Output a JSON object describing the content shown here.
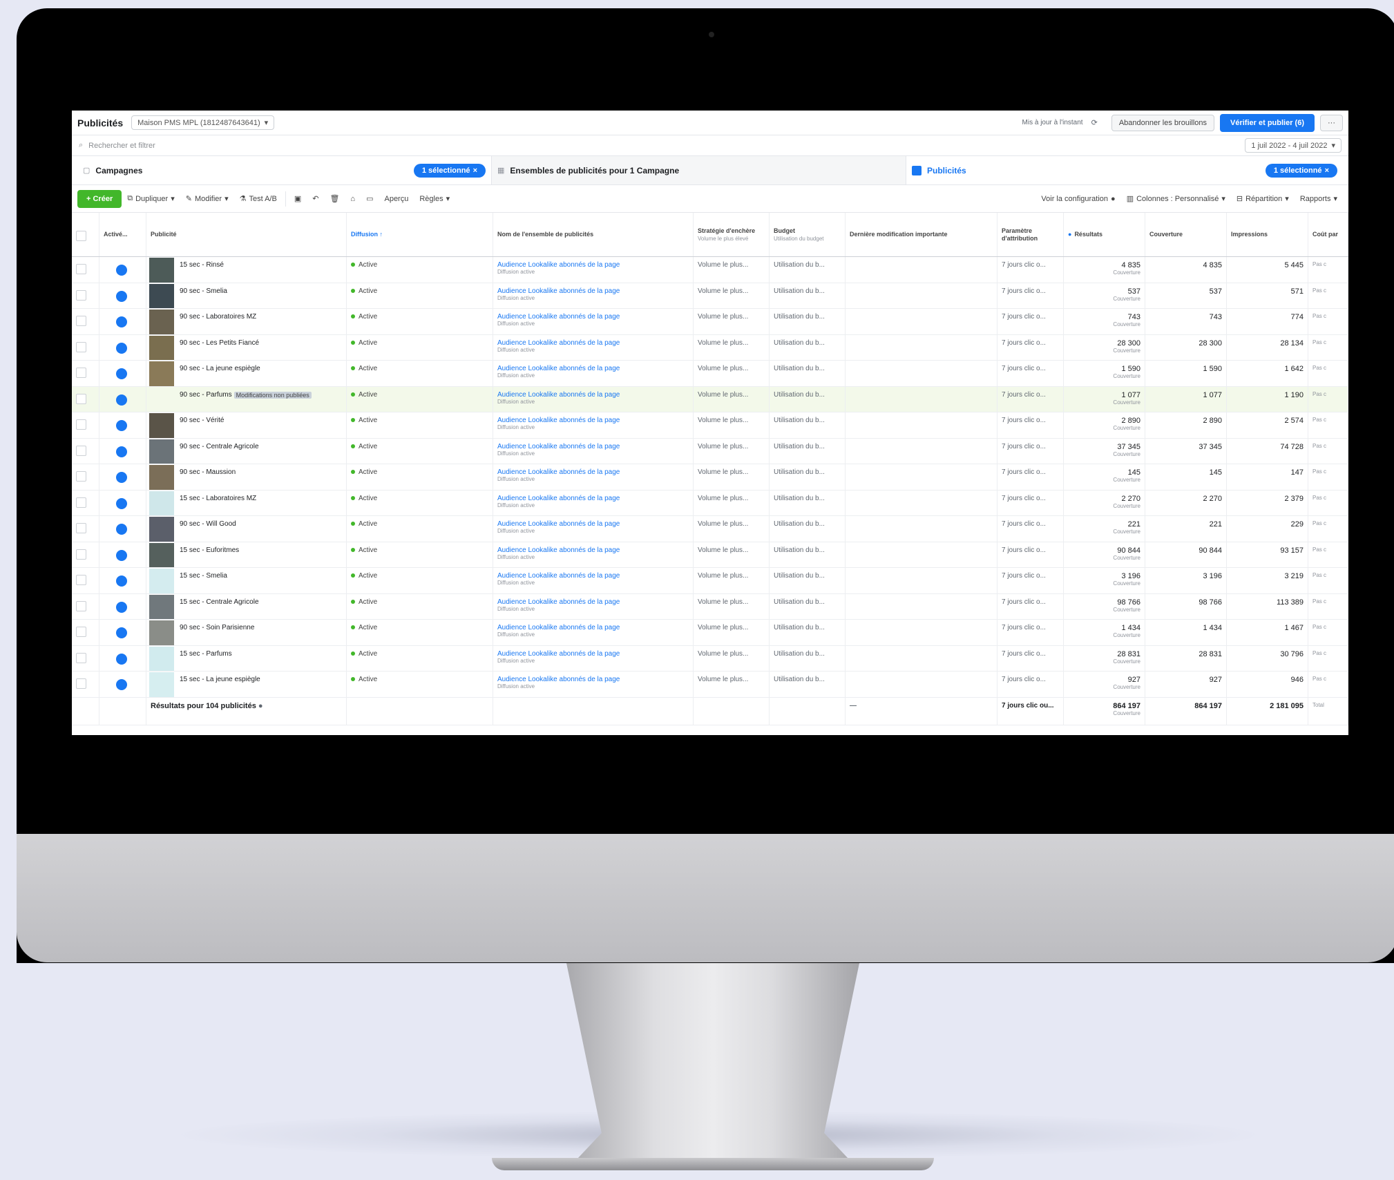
{
  "topbar": {
    "title": "Publicités",
    "account": "Maison PMS MPL (1812487643641)",
    "update": "Mis à jour à l'instant",
    "discard": "Abandonner les brouillons",
    "publish": "Vérifier et publier (6)",
    "more": "···"
  },
  "search": {
    "placeholder": "Rechercher et filtrer",
    "daterange": "1 juil 2022 - 4 juil 2022"
  },
  "tabs": {
    "campaigns": "Campagnes",
    "campaigns_pill": "1 sélectionné",
    "adsets": "Ensembles de publicités pour 1 Campagne",
    "ads": "Publicités",
    "ads_pill": "1 sélectionné"
  },
  "toolbar": {
    "create": "+ Créer",
    "duplicate": "Dupliquer",
    "edit": "Modifier",
    "ab_test": "Test A/B",
    "preview": "Aperçu",
    "rules": "Règles",
    "config": "Voir la configuration",
    "columns": "Colonnes : Personnalisé",
    "breakdown": "Répartition",
    "reports": "Rapports"
  },
  "columns": {
    "active": "Activé...",
    "ad": "Publicité",
    "delivery": "Diffusion ↑",
    "adset": "Nom de l'ensemble de publicités",
    "strategy": "Stratégie d'enchère",
    "strategy_sub": "Volume le plus élevé",
    "budget": "Budget",
    "budget_sub": "Utilisation du budget",
    "recent": "Dernière modification importante",
    "attribution": "Paramètre d'attribution",
    "results": "Résultats",
    "impressions": "Couverture",
    "reach": "Impressions",
    "cost": "Coût par"
  },
  "rows": [
    {
      "name": "15 sec - Rinsé",
      "set": "Audience Lookalike abonnés de la page",
      "results": "4 835",
      "imp": "4 835",
      "reach": "5 445",
      "thumb": "#4d5b58"
    },
    {
      "name": "90 sec - Smelia",
      "set": "Audience Lookalike abonnés de la page",
      "results": "537",
      "imp": "537",
      "reach": "571",
      "thumb": "#3d4a52"
    },
    {
      "name": "90 sec - Laboratoires MZ",
      "set": "Audience Lookalike abonnés de la page",
      "results": "743",
      "imp": "743",
      "reach": "774",
      "thumb": "#6a6250"
    },
    {
      "name": "90 sec - Les Petits Fiancé",
      "set": "Audience Lookalike abonnés de la page",
      "results": "28 300",
      "imp": "28 300",
      "reach": "28 134",
      "thumb": "#7a6e4f"
    },
    {
      "name": "90 sec - La jeune espiègle",
      "set": "Audience Lookalike abonnés de la page",
      "results": "1 590",
      "imp": "1 590",
      "reach": "1 642",
      "thumb": "#8a7a58"
    },
    {
      "name": "90 sec - Parfums",
      "tag": "Modifications non publiées",
      "set": "Audience Lookalike abonnés de la page",
      "results": "1 077",
      "imp": "1 077",
      "reach": "1 190",
      "thumb": "",
      "hl": true
    },
    {
      "name": "90 sec - Vérité",
      "set": "Audience Lookalike abonnés de la page",
      "results": "2 890",
      "imp": "2 890",
      "reach": "2 574",
      "thumb": "#5a5448"
    },
    {
      "name": "90 sec - Centrale Agricole",
      "set": "Audience Lookalike abonnés de la page",
      "results": "37 345",
      "imp": "37 345",
      "reach": "74 728",
      "thumb": "#6b7378"
    },
    {
      "name": "90 sec - Maussion",
      "set": "Audience Lookalike abonnés de la page",
      "results": "145",
      "imp": "145",
      "reach": "147",
      "thumb": "#7b6e58"
    },
    {
      "name": "15 sec - Laboratoires MZ",
      "set": "Audience Lookalike abonnés de la page",
      "results": "2 270",
      "imp": "2 270",
      "reach": "2 379",
      "thumb": "#cfe7ea"
    },
    {
      "name": "90 sec - Will Good",
      "set": "Audience Lookalike abonnés de la page",
      "results": "221",
      "imp": "221",
      "reach": "229",
      "thumb": "#5b5f6a"
    },
    {
      "name": "15 sec - Euforitmes",
      "set": "Audience Lookalike abonnés de la page",
      "results": "90 844",
      "imp": "90 844",
      "reach": "93 157",
      "thumb": "#55605d"
    },
    {
      "name": "15 sec - Smelia",
      "set": "Audience Lookalike abonnés de la page",
      "results": "3 196",
      "imp": "3 196",
      "reach": "3 219",
      "thumb": "#d4ecef"
    },
    {
      "name": "15 sec - Centrale Agricole",
      "set": "Audience Lookalike abonnés de la page",
      "results": "98 766",
      "imp": "98 766",
      "reach": "113 389",
      "thumb": "#70787c"
    },
    {
      "name": "90 sec - Soin Parisienne",
      "set": "Audience Lookalike abonnés de la page",
      "results": "1 434",
      "imp": "1 434",
      "reach": "1 467",
      "thumb": "#8a8d88"
    },
    {
      "name": "15 sec - Parfums",
      "set": "Audience Lookalike abonnés de la page",
      "results": "28 831",
      "imp": "28 831",
      "reach": "30 796",
      "thumb": "#d1ebee"
    },
    {
      "name": "15 sec - La jeune espiègle",
      "set": "Audience Lookalike abonnés de la page",
      "results": "927",
      "imp": "927",
      "reach": "946",
      "thumb": "#d6eef0"
    }
  ],
  "row_common": {
    "status": "Active",
    "set_sub": "Diffusion active",
    "strategy": "Volume le plus...",
    "budget": "Utilisation du b...",
    "attribution": "7 jours clic o...",
    "result_sub": "Couverture",
    "cost": "Pas c"
  },
  "footer": {
    "label": "Résultats pour 104 publicités",
    "recent": "—",
    "attribution": "7 jours clic ou...",
    "results": "864 197",
    "impressions": "864 197",
    "reach": "2 181 095",
    "sub": "Couverture",
    "cost": "Total"
  }
}
